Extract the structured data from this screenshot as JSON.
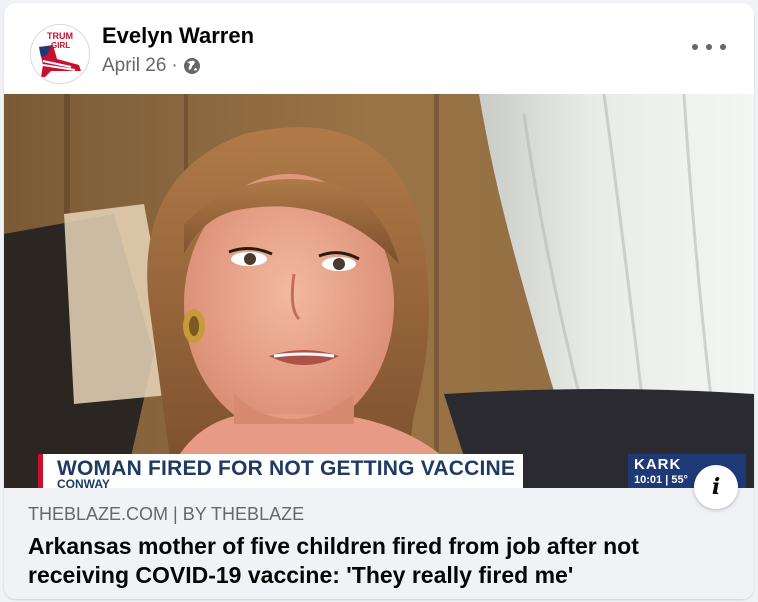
{
  "post": {
    "author": "Evelyn Warren",
    "date": "April 26",
    "separator": "·",
    "privacy_icon": "globe-icon",
    "more_icon": "more-options-icon",
    "avatar_text_top": "TRUM",
    "avatar_text_bottom": "GIRL"
  },
  "video_frame": {
    "lower_third_headline": "WOMAN FIRED FOR NOT GETTING VACCINE",
    "lower_third_location": "CONWAY",
    "station_name": "KARK",
    "station_time": "10:01 | 55°"
  },
  "link": {
    "source": "THEBLAZE.COM | BY THEBLAZE",
    "title": "Arkansas mother of five children fired from job after not receiving COVID-19 vaccine: 'They really fired me'",
    "info_label": "i"
  },
  "colors": {
    "card_bg": "#ffffff",
    "page_bg": "#f0f2f5",
    "preview_bg": "#f0f2f5",
    "secondary_text": "#65676b",
    "primary_text": "#050505",
    "news_red": "#c8102e",
    "news_blue": "#1f3b63"
  }
}
